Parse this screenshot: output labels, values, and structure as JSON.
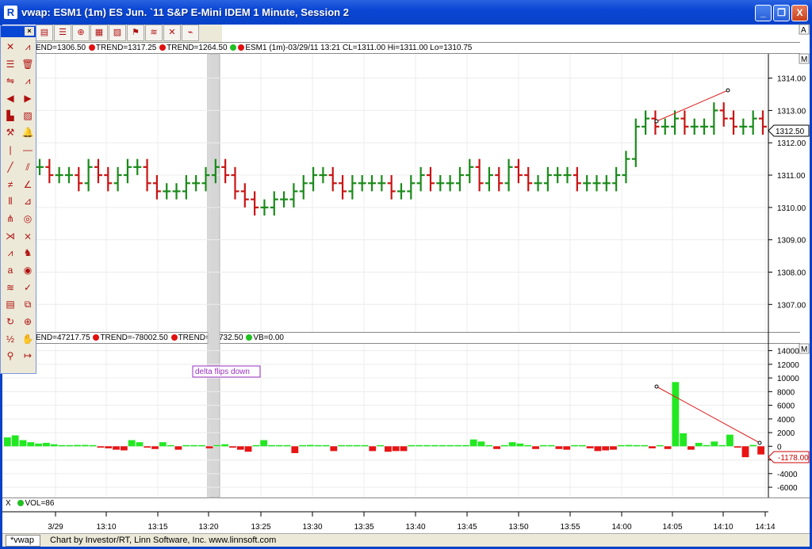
{
  "window": {
    "title": "vwap: ESM1 (1m) ES Jun. `11 S&P E-Mini IDEM 1 Minute, Session 2",
    "min_label": "_",
    "max_label": "❐",
    "close_label": "X"
  },
  "price_panel": {
    "info": [
      {
        "color": "red",
        "text": "END=1306.50"
      },
      {
        "color": "red",
        "text": "TREND=1317.25"
      },
      {
        "color": "red",
        "text": "TREND=1264.50"
      },
      {
        "color": "redgreen",
        "text": "ESM1 (1m)-03/29/11 13:21 CL=1311.00 Hi=1311.00 Lo=1310.75"
      }
    ],
    "last_price": "1312.50",
    "corner_label": "A",
    "corner_label2": "M"
  },
  "delta_panel": {
    "info": [
      {
        "color": "none",
        "text": "END=47217.75"
      },
      {
        "color": "red",
        "text": "TREND=-78002.50"
      },
      {
        "color": "red",
        "text": "TREND=66732.50"
      },
      {
        "color": "green",
        "text": "VB=0.00"
      }
    ],
    "annotation": "delta flips down",
    "last_value": "-1178.00",
    "corner_label": "M"
  },
  "volume_panel": {
    "close_label": "X",
    "info_text": "VOL=86"
  },
  "status": {
    "tab_label": "*vwap",
    "credit": "Chart by Investor/RT, Linn Software, Inc. www.linnsoft.com"
  },
  "colors": {
    "up": "#1a8a1a",
    "down": "#c81414",
    "delta_up": "#22e822",
    "delta_down": "#e81414",
    "trend": "#e02020",
    "highlight": "#d4d4d4"
  },
  "chart_data": [
    {
      "type": "ohlc",
      "title": "",
      "y_ticks": [
        "1314.00",
        "1313.00",
        "1312.00",
        "1311.00",
        "1310.00",
        "1309.00",
        "1308.00",
        "1307.00"
      ],
      "y_tick_values": [
        1314,
        1313,
        1312,
        1311,
        1310,
        1309,
        1308,
        1307
      ],
      "ylim": [
        1306.15,
        1314.75
      ],
      "closes": [
        1311.25,
        1311.0,
        1311.0,
        1311.0,
        1310.75,
        1311.25,
        1311.0,
        1310.75,
        1311.0,
        1311.25,
        1311.25,
        1310.75,
        1310.5,
        1310.5,
        1310.5,
        1310.75,
        1310.75,
        1311.0,
        1311.25,
        1311.0,
        1310.5,
        1310.25,
        1310.0,
        1310.0,
        1310.25,
        1310.25,
        1310.5,
        1310.75,
        1311.0,
        1311.0,
        1310.75,
        1310.5,
        1310.75,
        1310.75,
        1310.75,
        1310.75,
        1310.5,
        1310.5,
        1310.75,
        1311.0,
        1310.75,
        1310.75,
        1310.75,
        1311.0,
        1311.25,
        1310.75,
        1311.0,
        1310.75,
        1311.25,
        1311.0,
        1310.75,
        1310.75,
        1311.0,
        1311.0,
        1311.0,
        1310.75,
        1310.75,
        1310.75,
        1310.75,
        1311.0,
        1311.5,
        1312.5,
        1312.75,
        1312.5,
        1312.5,
        1312.75,
        1312.5,
        1312.5,
        1312.5,
        1313.0,
        1312.75,
        1312.5,
        1312.5,
        1312.75,
        1312.5
      ],
      "x_ticks": [
        "3/29",
        "13:10",
        "13:15",
        "13:20",
        "13:25",
        "13:30",
        "13:35",
        "13:40",
        "13:45",
        "13:50",
        "13:55",
        "14:00",
        "14:05",
        "14:10",
        "14:14"
      ]
    },
    {
      "type": "bar",
      "title": "",
      "y_ticks": [
        "14000",
        "12000",
        "10000",
        "8000",
        "6000",
        "4000",
        "2000",
        "0",
        "-2000",
        "-4000",
        "-6000"
      ],
      "y_tick_values": [
        14000,
        12000,
        10000,
        8000,
        6000,
        4000,
        2000,
        0,
        -2000,
        -4000,
        -6000
      ],
      "ylim": [
        -7500,
        15000
      ],
      "values": [
        1300,
        1600,
        900,
        600,
        400,
        500,
        300,
        0,
        100,
        200,
        200,
        0,
        -200,
        -300,
        -500,
        -600,
        900,
        600,
        -200,
        -400,
        600,
        0,
        -500,
        0,
        0,
        0,
        -300,
        0,
        300,
        -200,
        -500,
        -800,
        0,
        900,
        0,
        0,
        0,
        -1000,
        0,
        200,
        0,
        0,
        -700,
        0,
        0,
        0,
        0,
        -700,
        0,
        -800,
        -700,
        -700,
        0,
        0,
        0,
        0,
        0,
        0,
        0,
        0,
        1000,
        700,
        0,
        -400,
        0,
        600,
        400,
        0,
        -400,
        0,
        0,
        -400,
        -500,
        0,
        0,
        -300,
        -700,
        -600,
        -500,
        0,
        200,
        0,
        0,
        -300,
        0,
        -400,
        9400,
        1900,
        -500,
        500,
        0,
        700,
        0,
        1700,
        -200,
        -1600,
        200,
        -1200
      ],
      "x_ticks": [
        "3/29",
        "13:10",
        "13:15",
        "13:20",
        "13:25",
        "13:30",
        "13:35",
        "13:40",
        "13:45",
        "13:50",
        "13:55",
        "14:00",
        "14:05",
        "14:10",
        "14:14"
      ]
    }
  ]
}
